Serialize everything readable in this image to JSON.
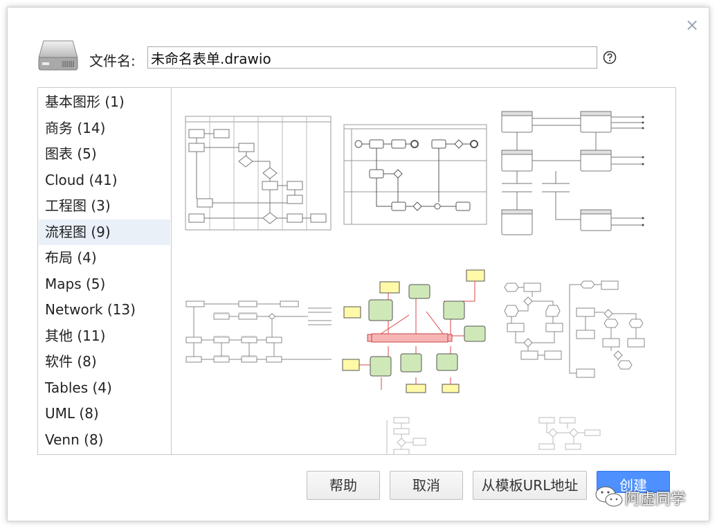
{
  "dialog": {
    "close_label": "×",
    "filename_label": "文件名:",
    "filename_value": "未命名表单.drawio",
    "help_icon": "help-circle-icon"
  },
  "categories": [
    {
      "label": "基本图形 (1)",
      "selected": false
    },
    {
      "label": "商务 (14)",
      "selected": false
    },
    {
      "label": "图表 (5)",
      "selected": false
    },
    {
      "label": "Cloud (41)",
      "selected": false
    },
    {
      "label": "工程图 (3)",
      "selected": false
    },
    {
      "label": "流程图 (9)",
      "selected": true
    },
    {
      "label": "布局 (4)",
      "selected": false
    },
    {
      "label": "Maps (5)",
      "selected": false
    },
    {
      "label": "Network (13)",
      "selected": false
    },
    {
      "label": "其他 (11)",
      "selected": false
    },
    {
      "label": "软件 (8)",
      "selected": false
    },
    {
      "label": "Tables (4)",
      "selected": false
    },
    {
      "label": "UML (8)",
      "selected": false
    },
    {
      "label": "Venn (8)",
      "selected": false
    }
  ],
  "buttons": {
    "help": "帮助",
    "cancel": "取消",
    "from_url": "从模板URL地址",
    "create": "创建"
  },
  "watermark": {
    "text": "阿虚同学"
  },
  "colors": {
    "accent": "#4d90fe",
    "selected_bg": "#e9f0f8",
    "close_icon": "#9aa5b5"
  }
}
